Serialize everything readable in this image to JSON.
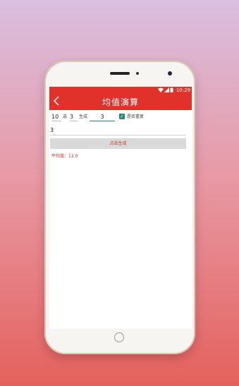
{
  "status": {
    "time": "10:29"
  },
  "appbar": {
    "title": "均值演算"
  },
  "form": {
    "count_value": "10",
    "count_label": "选",
    "groups_value": "3",
    "generate_label": "生成",
    "range_value": "3",
    "repeat_checkbox_label": "是否重复",
    "repeat_checked": true
  },
  "result": {
    "value": "3"
  },
  "button": {
    "label": "点击生成"
  },
  "average": {
    "text": "平均值：12.0"
  },
  "colors": {
    "accent": "#e0322a",
    "checkbox": "#1d8a7a"
  }
}
